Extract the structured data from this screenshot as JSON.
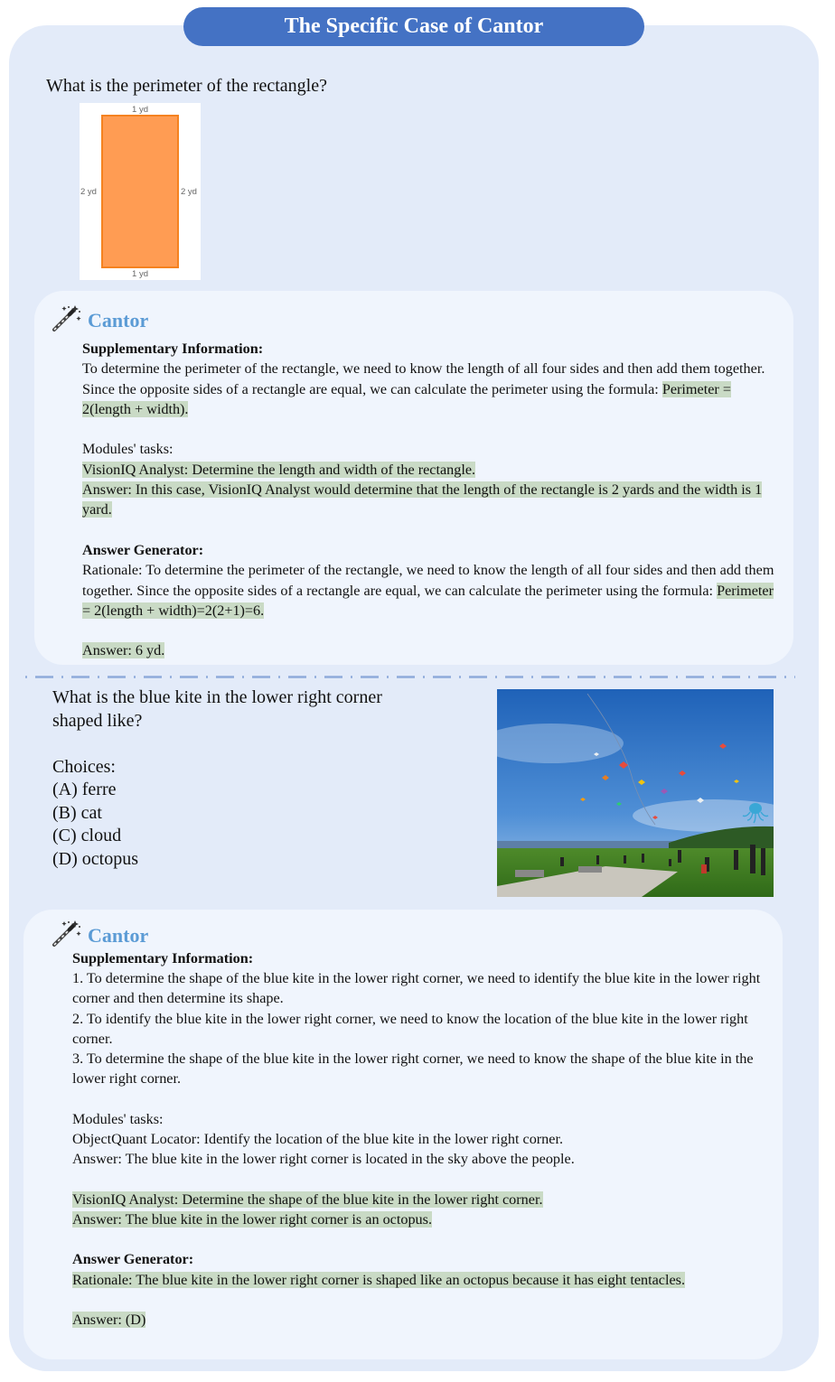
{
  "title": "The Specific Case of Cantor",
  "case1": {
    "question": "What is the perimeter of the rectangle?",
    "figure": {
      "top_label": "1 yd",
      "bottom_label": "1 yd",
      "left_label": "2 yd",
      "right_label": "2 yd",
      "fill_color": "#ff9c53",
      "stroke_color": "#f58220"
    },
    "cantor": {
      "name": "Cantor",
      "icon": "magic-wand-icon",
      "supp_heading": "Supplementary Information:",
      "supp_text": "To determine the perimeter of the rectangle, we need to know the length of all four sides and then add them together. Since the opposite sides of a rectangle are equal, we can calculate the perimeter using the formula:",
      "supp_formula": "Perimeter = 2(length + width).",
      "modules_heading": "Modules' tasks:",
      "task": "VisionIQ Analyst: Determine the length and width of the rectangle.",
      "task_answer": "Answer: In this case, VisionIQ Analyst would determine that the length of the rectangle is 2 yards and the width is 1 yard.",
      "gen_heading": "Answer Generator:",
      "rationale": "Rationale: To determine the perimeter of the rectangle, we need to know the length of all four sides and then add them together. Since the opposite sides of a rectangle are equal, we can calculate the perimeter using the formula:",
      "rationale_formula": "Perimeter = 2(length + width)=2(2+1)=6.",
      "final_answer": "Answer: 6 yd."
    }
  },
  "case2": {
    "question_line1": "What is the blue kite in the lower right corner",
    "question_line2": "shaped like?",
    "choices_heading": "Choices:",
    "choices": [
      "(A) ferre",
      "(B) cat",
      "(C) cloud",
      "(D) octopus"
    ],
    "cantor": {
      "name": "Cantor",
      "icon": "magic-wand-icon",
      "supp_heading": "Supplementary Information:",
      "supp_1": "1. To determine the shape of the blue kite in the lower right corner, we need to identify the blue kite in the lower right corner and then determine its shape.",
      "supp_2": "2. To identify the blue kite in the lower right corner, we need to know the location of the blue kite in the lower right corner.",
      "supp_3": "3. To determine the shape of the blue kite in the lower right corner, we need to know the shape of the blue kite in the lower right corner.",
      "modules_heading": "Modules' tasks:",
      "task1": "ObjectQuant Locator: Identify the location of the blue kite in the lower right corner.",
      "task1_answer": "Answer: The blue kite in the lower right corner is located in the sky above the people.",
      "task2": "VisionIQ Analyst: Determine the shape of the blue kite in the lower right corner.",
      "task2_answer": "Answer: The blue kite in the lower right corner is an octopus.",
      "gen_heading": "Answer Generator:",
      "rationale": "Rationale: The blue kite in the lower right corner is shaped like an octopus because it has eight tentacles.",
      "final_answer": "Answer: (D)"
    }
  },
  "colors": {
    "title_bg": "#4472c4",
    "outer_bg": "#e3ebf9",
    "card_bg": "#f0f5fd",
    "highlight": "#c9dac5",
    "cantor_name": "#5b9bd5"
  }
}
